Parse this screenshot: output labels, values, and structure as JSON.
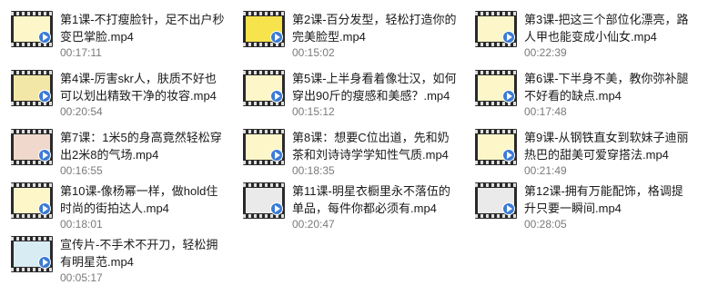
{
  "items": [
    {
      "title": "第1课-不打瘦脸针，足不出户秒变巴掌脸.mp4",
      "duration": "00:17:11",
      "screen": "#fdf6c8"
    },
    {
      "title": "第2课-百分发型，轻松打造你的完美脸型.mp4",
      "duration": "00:15:02",
      "screen": "#f7e34c"
    },
    {
      "title": "第3课-把这三个部位化漂亮，路人甲也能变成小仙女.mp4",
      "duration": "00:22:39",
      "screen": "#fdf6c8"
    },
    {
      "title": "第4课-厉害skr人，肤质不好也可以划出精致干净的妆容.mp4",
      "duration": "00:20:54",
      "screen": "#f3e7a8"
    },
    {
      "title": "第5课-上半身看着像壮汉，如何穿出90斤的瘦感和美感？.mp4",
      "duration": "00:15:12",
      "screen": "#fdf6c8"
    },
    {
      "title": "第6课-下半身不美，教你弥补腿不好看的缺点.mp4",
      "duration": "00:17:48",
      "screen": "#fdf6c8"
    },
    {
      "title": "第7课：1米5的身高竟然轻松穿出2米8的气场.mp4",
      "duration": "00:16:55",
      "screen": "#f0d8cc"
    },
    {
      "title": "第8课：想要C位出道，先和奶茶和刘诗诗学学知性气质.mp4",
      "duration": "00:18:35",
      "screen": "#fdf6c8"
    },
    {
      "title": "第9课-从钢铁直女到软妹子迪丽热巴的甜美可爱穿搭法.mp4",
      "duration": "00:21:49",
      "screen": "#fdf6c8"
    },
    {
      "title": "第10课-像杨幂一样，做hold住时尚的街拍达人.mp4",
      "duration": "00:18:01",
      "screen": "#fdf6c8"
    },
    {
      "title": "第11课-明星衣橱里永不落伍的单品，每件你都必须有.mp4",
      "duration": "00:20:47",
      "screen": "#eaeaea"
    },
    {
      "title": "第12课-拥有万能配饰，格调提升只要一瞬间.mp4",
      "duration": "00:28:05",
      "screen": "#eaeaea"
    },
    {
      "title": "宣传片-不手术不开刀，轻松拥有明星范.mp4",
      "duration": "00:05:17",
      "screen": "#d8ecf4"
    }
  ]
}
